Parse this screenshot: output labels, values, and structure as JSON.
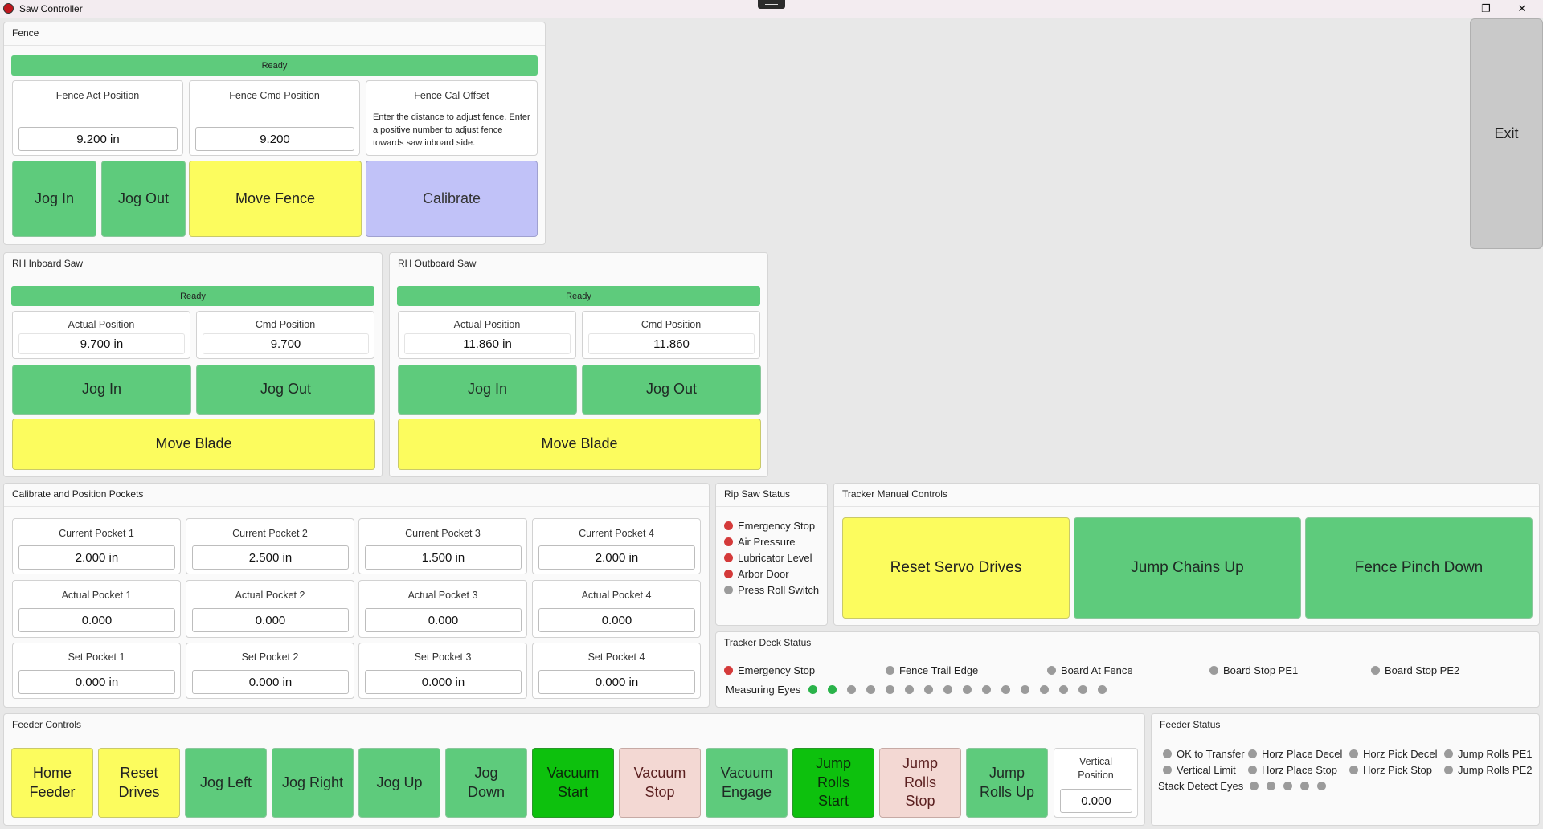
{
  "window": {
    "title": "Saw Controller",
    "minimize_glyph": "—",
    "restore_glyph": "❐",
    "close_glyph": "✕"
  },
  "exit": {
    "label": "Exit"
  },
  "fence": {
    "title": "Fence",
    "status": "Ready",
    "act_label": "Fence Act Position",
    "act_value": "9.200 in",
    "cmd_label": "Fence Cmd Position",
    "cmd_value": "9.200",
    "cal_label": "Fence Cal Offset",
    "cal_help": "Enter the distance to adjust fence. Enter a positive number to adjust fence towards saw inboard side.",
    "buttons": {
      "jog_in": "Jog In",
      "jog_out": "Jog Out",
      "move": "Move Fence",
      "calibrate": "Calibrate"
    }
  },
  "inboard": {
    "title": "RH Inboard Saw",
    "status": "Ready",
    "actual_label": "Actual Position",
    "actual_value": "9.700 in",
    "cmd_label": "Cmd Position",
    "cmd_value": "9.700",
    "jog_in": "Jog In",
    "jog_out": "Jog Out",
    "move": "Move Blade"
  },
  "outboard": {
    "title": "RH Outboard Saw",
    "status": "Ready",
    "actual_label": "Actual Position",
    "actual_value": "11.860 in",
    "cmd_label": "Cmd Position",
    "cmd_value": "11.860",
    "jog_in": "Jog In",
    "jog_out": "Jog Out",
    "move": "Move Blade"
  },
  "pockets": {
    "title": "Calibrate and Position Pockets",
    "current": [
      {
        "label": "Current Pocket 1",
        "value": "2.000 in"
      },
      {
        "label": "Current Pocket 2",
        "value": "2.500 in"
      },
      {
        "label": "Current Pocket 3",
        "value": "1.500 in"
      },
      {
        "label": "Current Pocket 4",
        "value": "2.000 in"
      }
    ],
    "actual": [
      {
        "label": "Actual Pocket 1",
        "value": "0.000"
      },
      {
        "label": "Actual Pocket 2",
        "value": "0.000"
      },
      {
        "label": "Actual Pocket 3",
        "value": "0.000"
      },
      {
        "label": "Actual Pocket 4",
        "value": "0.000"
      }
    ],
    "set": [
      {
        "label": "Set Pocket 1",
        "value": "0.000 in"
      },
      {
        "label": "Set Pocket 2",
        "value": "0.000 in"
      },
      {
        "label": "Set Pocket 3",
        "value": "0.000 in"
      },
      {
        "label": "Set Pocket 4",
        "value": "0.000 in"
      }
    ]
  },
  "rip": {
    "title": "Rip Saw Status",
    "items": [
      {
        "label": "Emergency Stop",
        "state": "red"
      },
      {
        "label": "Air Pressure",
        "state": "red"
      },
      {
        "label": "Lubricator Level",
        "state": "red"
      },
      {
        "label": "Arbor Door",
        "state": "red"
      },
      {
        "label": "Press Roll Switch",
        "state": "gray"
      }
    ]
  },
  "tracker_manual": {
    "title": "Tracker Manual Controls",
    "reset": "Reset Servo Drives",
    "chains": "Jump Chains Up",
    "pinch": "Fence Pinch Down"
  },
  "deck": {
    "title": "Tracker Deck Status",
    "items": [
      {
        "label": "Emergency Stop",
        "state": "red"
      },
      {
        "label": "Fence Trail Edge",
        "state": "gray"
      },
      {
        "label": "Board At Fence",
        "state": "gray"
      },
      {
        "label": "Board Stop PE1",
        "state": "gray"
      },
      {
        "label": "Board Stop PE2",
        "state": "gray"
      }
    ],
    "eyes_label": "Measuring Eyes",
    "eyes": [
      "green",
      "green",
      "gray",
      "gray",
      "gray",
      "gray",
      "gray",
      "gray",
      "gray",
      "gray",
      "gray",
      "gray",
      "gray",
      "gray",
      "gray",
      "gray"
    ]
  },
  "feeder": {
    "title": "Feeder Controls",
    "buttons": [
      {
        "label": "Home\nFeeder",
        "style": "y"
      },
      {
        "label": "Reset\nDrives",
        "style": "y"
      },
      {
        "label": "Jog Left",
        "style": "g"
      },
      {
        "label": "Jog Right",
        "style": "g"
      },
      {
        "label": "Jog Up",
        "style": "g"
      },
      {
        "label": "Jog\nDown",
        "style": "g"
      },
      {
        "label": "Vacuum\nStart",
        "style": "dg"
      },
      {
        "label": "Vacuum\nStop",
        "style": "pk"
      },
      {
        "label": "Vacuum\nEngage",
        "style": "g"
      },
      {
        "label": "Jump\nRolls\nStart",
        "style": "dg"
      },
      {
        "label": "Jump\nRolls\nStop",
        "style": "pk"
      },
      {
        "label": "Jump\nRolls Up",
        "style": "g"
      }
    ],
    "vertical_label": "Vertical\nPosition",
    "vertical_value": "0.000"
  },
  "feeder_status": {
    "title": "Feeder Status",
    "row1": [
      "OK to Transfer",
      "Horz Place Decel",
      "Horz Pick Decel",
      "Jump Rolls PE1"
    ],
    "row2": [
      "Vertical Limit",
      "Horz Place Stop",
      "Horz Pick Stop",
      "Jump Rolls PE2"
    ],
    "stack_label": "Stack Detect Eyes",
    "stack_eyes": [
      "gray",
      "gray",
      "gray",
      "gray",
      "gray"
    ]
  }
}
